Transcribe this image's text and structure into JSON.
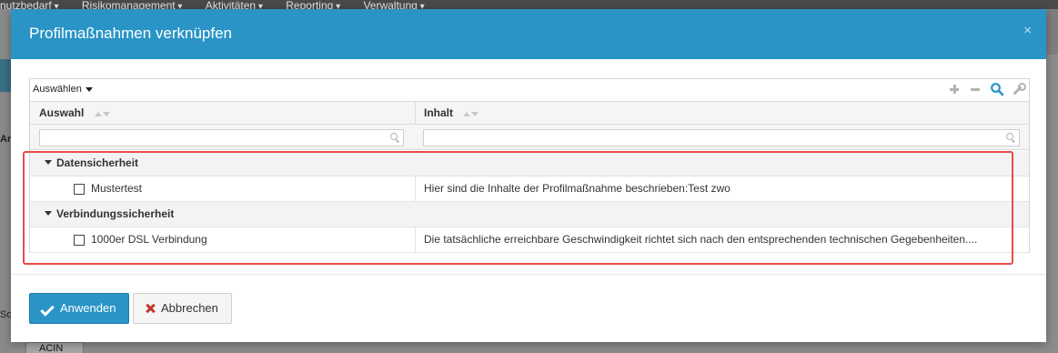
{
  "background": {
    "nav": [
      "nutzbedarf",
      "Risikomanagement",
      "Aktivitäten",
      "Reporting",
      "Verwaltung"
    ],
    "left_text_1": "An",
    "left_text_2": "So",
    "bottom_tab": "ACIN"
  },
  "modal": {
    "title": "Profilmaßnahmen verknüpfen",
    "close_label": "×"
  },
  "grid": {
    "select_label": "Auswählen",
    "columns": [
      "Auswahl",
      "Inhalt"
    ],
    "filters": [
      {
        "value": "",
        "placeholder": ""
      },
      {
        "value": "",
        "placeholder": ""
      }
    ],
    "groups": [
      {
        "label": "Datensicherheit",
        "rows": [
          {
            "name": "Mustertest",
            "content": "Hier sind die Inhalte der Profilmaßnahme beschrieben:Test zwo",
            "checked": false
          }
        ]
      },
      {
        "label": "Verbindungssicherheit",
        "rows": [
          {
            "name": "1000er DSL Verbindung",
            "content": "Die tatsächliche erreichbare Geschwindigkeit richtet sich nach den entsprechenden technischen Gegebenheiten....",
            "checked": false
          }
        ]
      }
    ]
  },
  "buttons": {
    "apply": "Anwenden",
    "cancel": "Abbrechen"
  },
  "colors": {
    "header": "#2a94c6",
    "highlight": "#e84c4c",
    "cancel_icon": "#c0392b"
  }
}
